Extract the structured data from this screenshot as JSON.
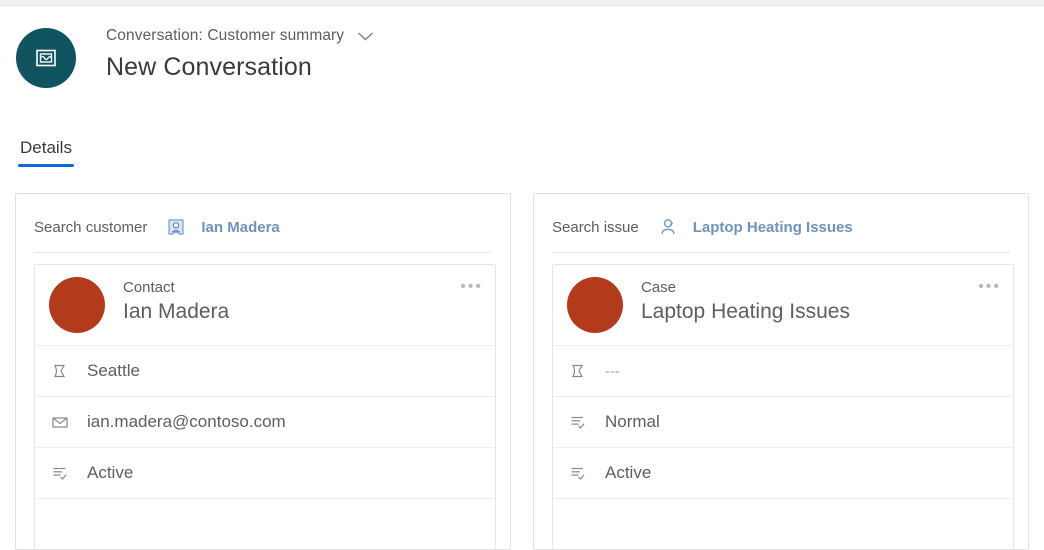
{
  "header": {
    "app_icon": "conversation-icon",
    "subtitle": "Conversation: Customer summary",
    "chevron_icon": "chevron-down-icon",
    "title": "New Conversation",
    "avatar_color": "#10545f"
  },
  "tabs": [
    {
      "label": "Details",
      "active": true
    }
  ],
  "accent": {
    "tab_underline": "#1267d6",
    "link_blue": "#6f93bd",
    "avatar_red": "#b43a1c"
  },
  "cards": [
    {
      "search": {
        "label": "Search customer",
        "entity_icon": "contact-card-icon",
        "value": "Ian Madera"
      },
      "record": {
        "type": "Contact",
        "name": "Ian Madera",
        "overflow_label": "•••",
        "attributes": [
          {
            "icon": "location-icon",
            "value": "Seattle",
            "muted": false
          },
          {
            "icon": "email-icon",
            "value": "ian.madera@contoso.com",
            "muted": false
          },
          {
            "icon": "status-icon",
            "value": "Active",
            "muted": false
          }
        ]
      }
    },
    {
      "search": {
        "label": "Search issue",
        "entity_icon": "case-person-icon",
        "value": "Laptop Heating Issues"
      },
      "record": {
        "type": "Case",
        "name": "Laptop Heating Issues",
        "overflow_label": "•••",
        "attributes": [
          {
            "icon": "location-icon",
            "value": "---",
            "muted": true
          },
          {
            "icon": "priority-icon",
            "value": "Normal",
            "muted": false
          },
          {
            "icon": "status-icon",
            "value": "Active",
            "muted": false
          }
        ]
      }
    }
  ]
}
